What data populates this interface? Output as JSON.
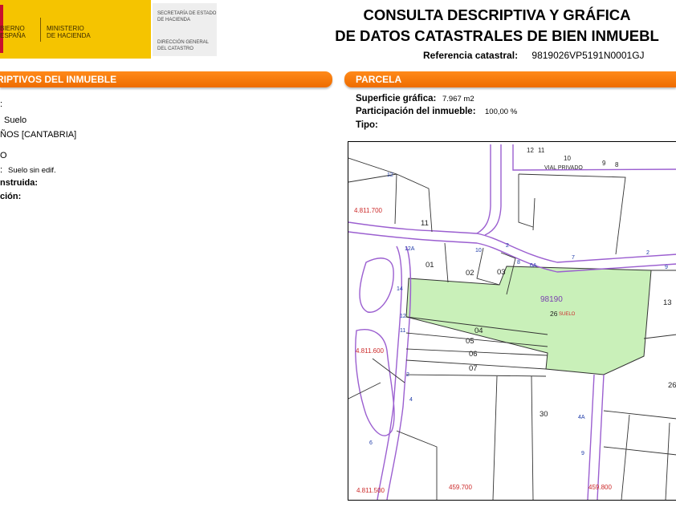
{
  "header": {
    "logo": {
      "left_line1": "BIERNO",
      "left_line2": "ESPAÑA",
      "ministry_line1": "MINISTERIO",
      "ministry_line2": "DE HACIENDA",
      "sec_line1": "SECRETARÍA DE ESTADO",
      "sec_line2": "DE HACIENDA",
      "dir_line1": "DIRECCIÓN GENERAL",
      "dir_line2": "DEL CATASTRO"
    },
    "title_line1": "CONSULTA DESCRIPTIVA Y GRÁFICA",
    "title_line2": "DE DATOS CATASTRALES DE BIEN INMUEBL",
    "ref_label": "Referencia catastral:",
    "ref_value": "9819026VP5191N0001GJ"
  },
  "left_section": {
    "heading": "RIPTIVOS DEL INMUEBLE",
    "rows": [
      {
        "text": ":",
        "bold": false
      },
      {
        "text": "Suelo",
        "bold": false
      },
      {
        "text": "ÑOS [CANTABRIA]",
        "bold": false
      },
      {
        "text": "O",
        "bold": false
      },
      {
        "text": ":",
        "bold": false
      },
      {
        "text": "Suelo sin edif.",
        "bold": false
      },
      {
        "text": "nstruida:",
        "bold": true
      },
      {
        "text": "ción:",
        "bold": true
      }
    ]
  },
  "parcela": {
    "heading": "PARCELA",
    "superficie_label": "Superficie gráfica:",
    "superficie_value": "7.967 m2",
    "participacion_label": "Participación del inmueble:",
    "participacion_value": "100,00 %",
    "tipo_label": "Tipo:"
  },
  "map": {
    "colors": {
      "parcel_fill": "#c9f0b9",
      "street": "#9b5fd0",
      "line": "#333333",
      "coord": "#cc2a2a"
    },
    "labels": {
      "n12a": "12",
      "n11a": "11",
      "n10": "10",
      "n9a": "9",
      "n8": "8",
      "n7a": "7",
      "n2a": "2",
      "n13a": "13",
      "vial": "VIAL PRIVADO",
      "p11": "11",
      "p01": "01",
      "p02": "02",
      "p03": "03",
      "p04": "04",
      "p05": "05",
      "p06": "06",
      "p07": "07",
      "parcel_id": "98190",
      "parcel_sub": "26",
      "parcel_sub_word": "SUELO",
      "p13": "13",
      "p30": "30",
      "p26": "26",
      "st_12": "12",
      "st_12a": "12A",
      "st_10": "10",
      "st_8": "8",
      "st_6a": "6A",
      "st_7": "7",
      "st_9": "9",
      "st_2": "2",
      "st_14": "14",
      "st_12b": "12",
      "st_11": "11",
      "st_2b": "2",
      "st_4": "4",
      "st_6": "6",
      "st_4a": "4A",
      "st_9b": "9",
      "st_2c": "2",
      "coord_y1": "4.811.700",
      "coord_y2": "4.811.600",
      "coord_y3": "4.811.500",
      "coord_x1": "459.700",
      "coord_x2": "459.800"
    }
  }
}
